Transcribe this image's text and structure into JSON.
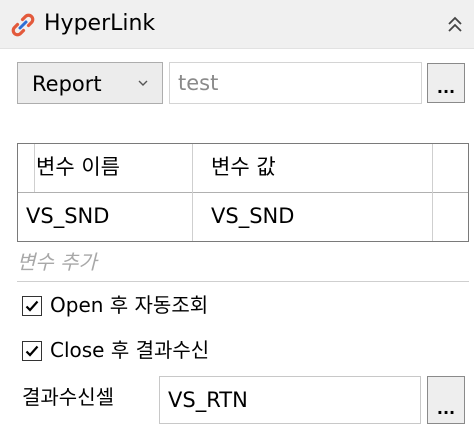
{
  "panel": {
    "title": "HyperLink",
    "icon": "hyperlink-icon",
    "collapse_icon": "double-chevron-up-icon"
  },
  "link": {
    "type_selected": "Report",
    "target_value": "test",
    "browse_label": "..."
  },
  "variables": {
    "columns": [
      "변수 이름",
      "변수 값"
    ],
    "rows": [
      {
        "name": "VS_SND",
        "value": "VS_SND"
      }
    ],
    "add_placeholder": "변수 추가"
  },
  "options": {
    "open_label": "Open 후 자동조회",
    "open_checked": true,
    "close_label": "Close 후 결과수신",
    "close_checked": true
  },
  "result": {
    "label": "결과수신셀",
    "value": "VS_RTN",
    "browse_label": "..."
  },
  "colors": {
    "icon_red": "#e35a3c",
    "icon_blue": "#2d6fd6"
  }
}
